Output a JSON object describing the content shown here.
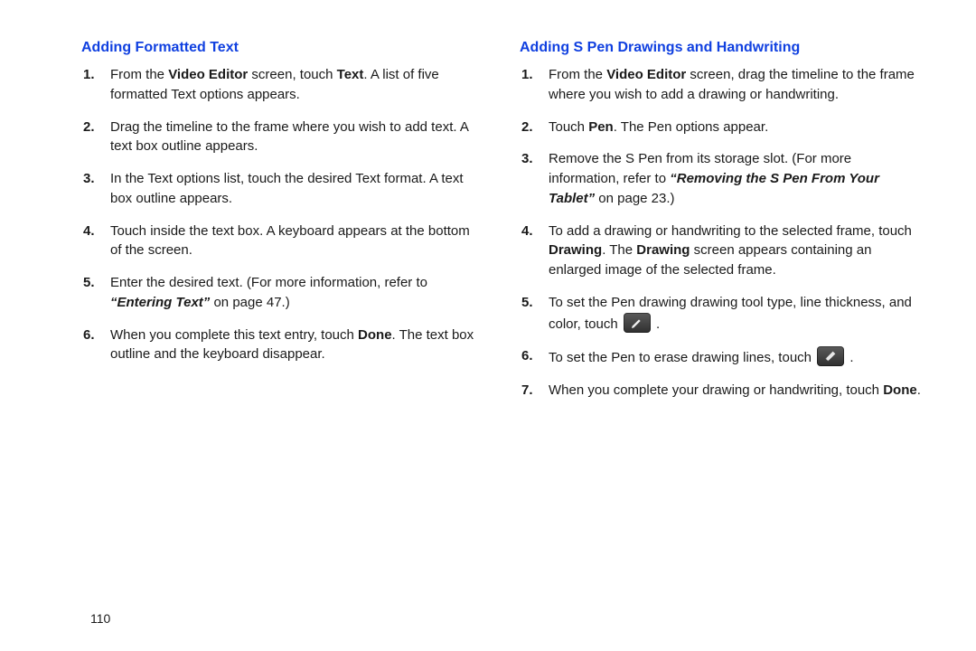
{
  "page_number": "110",
  "left": {
    "title": "Adding Formatted Text",
    "steps": [
      {
        "pre": "From the ",
        "b1": "Video Editor",
        "mid": " screen, touch ",
        "b2": "Text",
        "post": ". A list of five formatted Text options appears."
      },
      {
        "text": "Drag the timeline to the frame where you wish to add text. A text box outline appears."
      },
      {
        "text": "In the Text options list, touch the desired Text format. A text box outline appears."
      },
      {
        "text": "Touch inside the text box. A keyboard appears at the bottom of the screen."
      },
      {
        "pre": "Enter the desired text. (For more information, refer to ",
        "bi": "“Entering Text”",
        "post_i": " on page 47.)"
      },
      {
        "pre": "When you complete this text entry, touch ",
        "b1": "Done",
        "post": ". The text box outline and the keyboard disappear."
      }
    ]
  },
  "right": {
    "title": "Adding S Pen Drawings and Handwriting",
    "steps": [
      {
        "pre": "From the ",
        "b1": "Video Editor",
        "post": " screen, drag the timeline to the frame where you wish to add a drawing or handwriting."
      },
      {
        "pre": "Touch ",
        "b1": "Pen",
        "post": ". The Pen options appear."
      },
      {
        "pre": "Remove the S Pen from its storage slot. (For more information, refer to ",
        "bi": "“Removing the S Pen From Your Tablet”",
        "post_i": " on page 23.)"
      },
      {
        "pre": "To add a drawing or handwriting to the selected frame, touch ",
        "b1": "Drawing",
        "mid": ". The ",
        "b2": "Drawing",
        "post": " screen appears containing an enlarged image of the selected frame."
      },
      {
        "pre": "To set the Pen drawing drawing tool type, line thickness, and color, touch ",
        "icon": "pen-tool-icon",
        "post": " ."
      },
      {
        "pre": "To set the Pen to erase drawing lines, touch ",
        "icon": "eraser-icon",
        "post": " ."
      },
      {
        "pre": "When you complete your drawing or handwriting, touch ",
        "b1": "Done",
        "post": "."
      }
    ]
  }
}
